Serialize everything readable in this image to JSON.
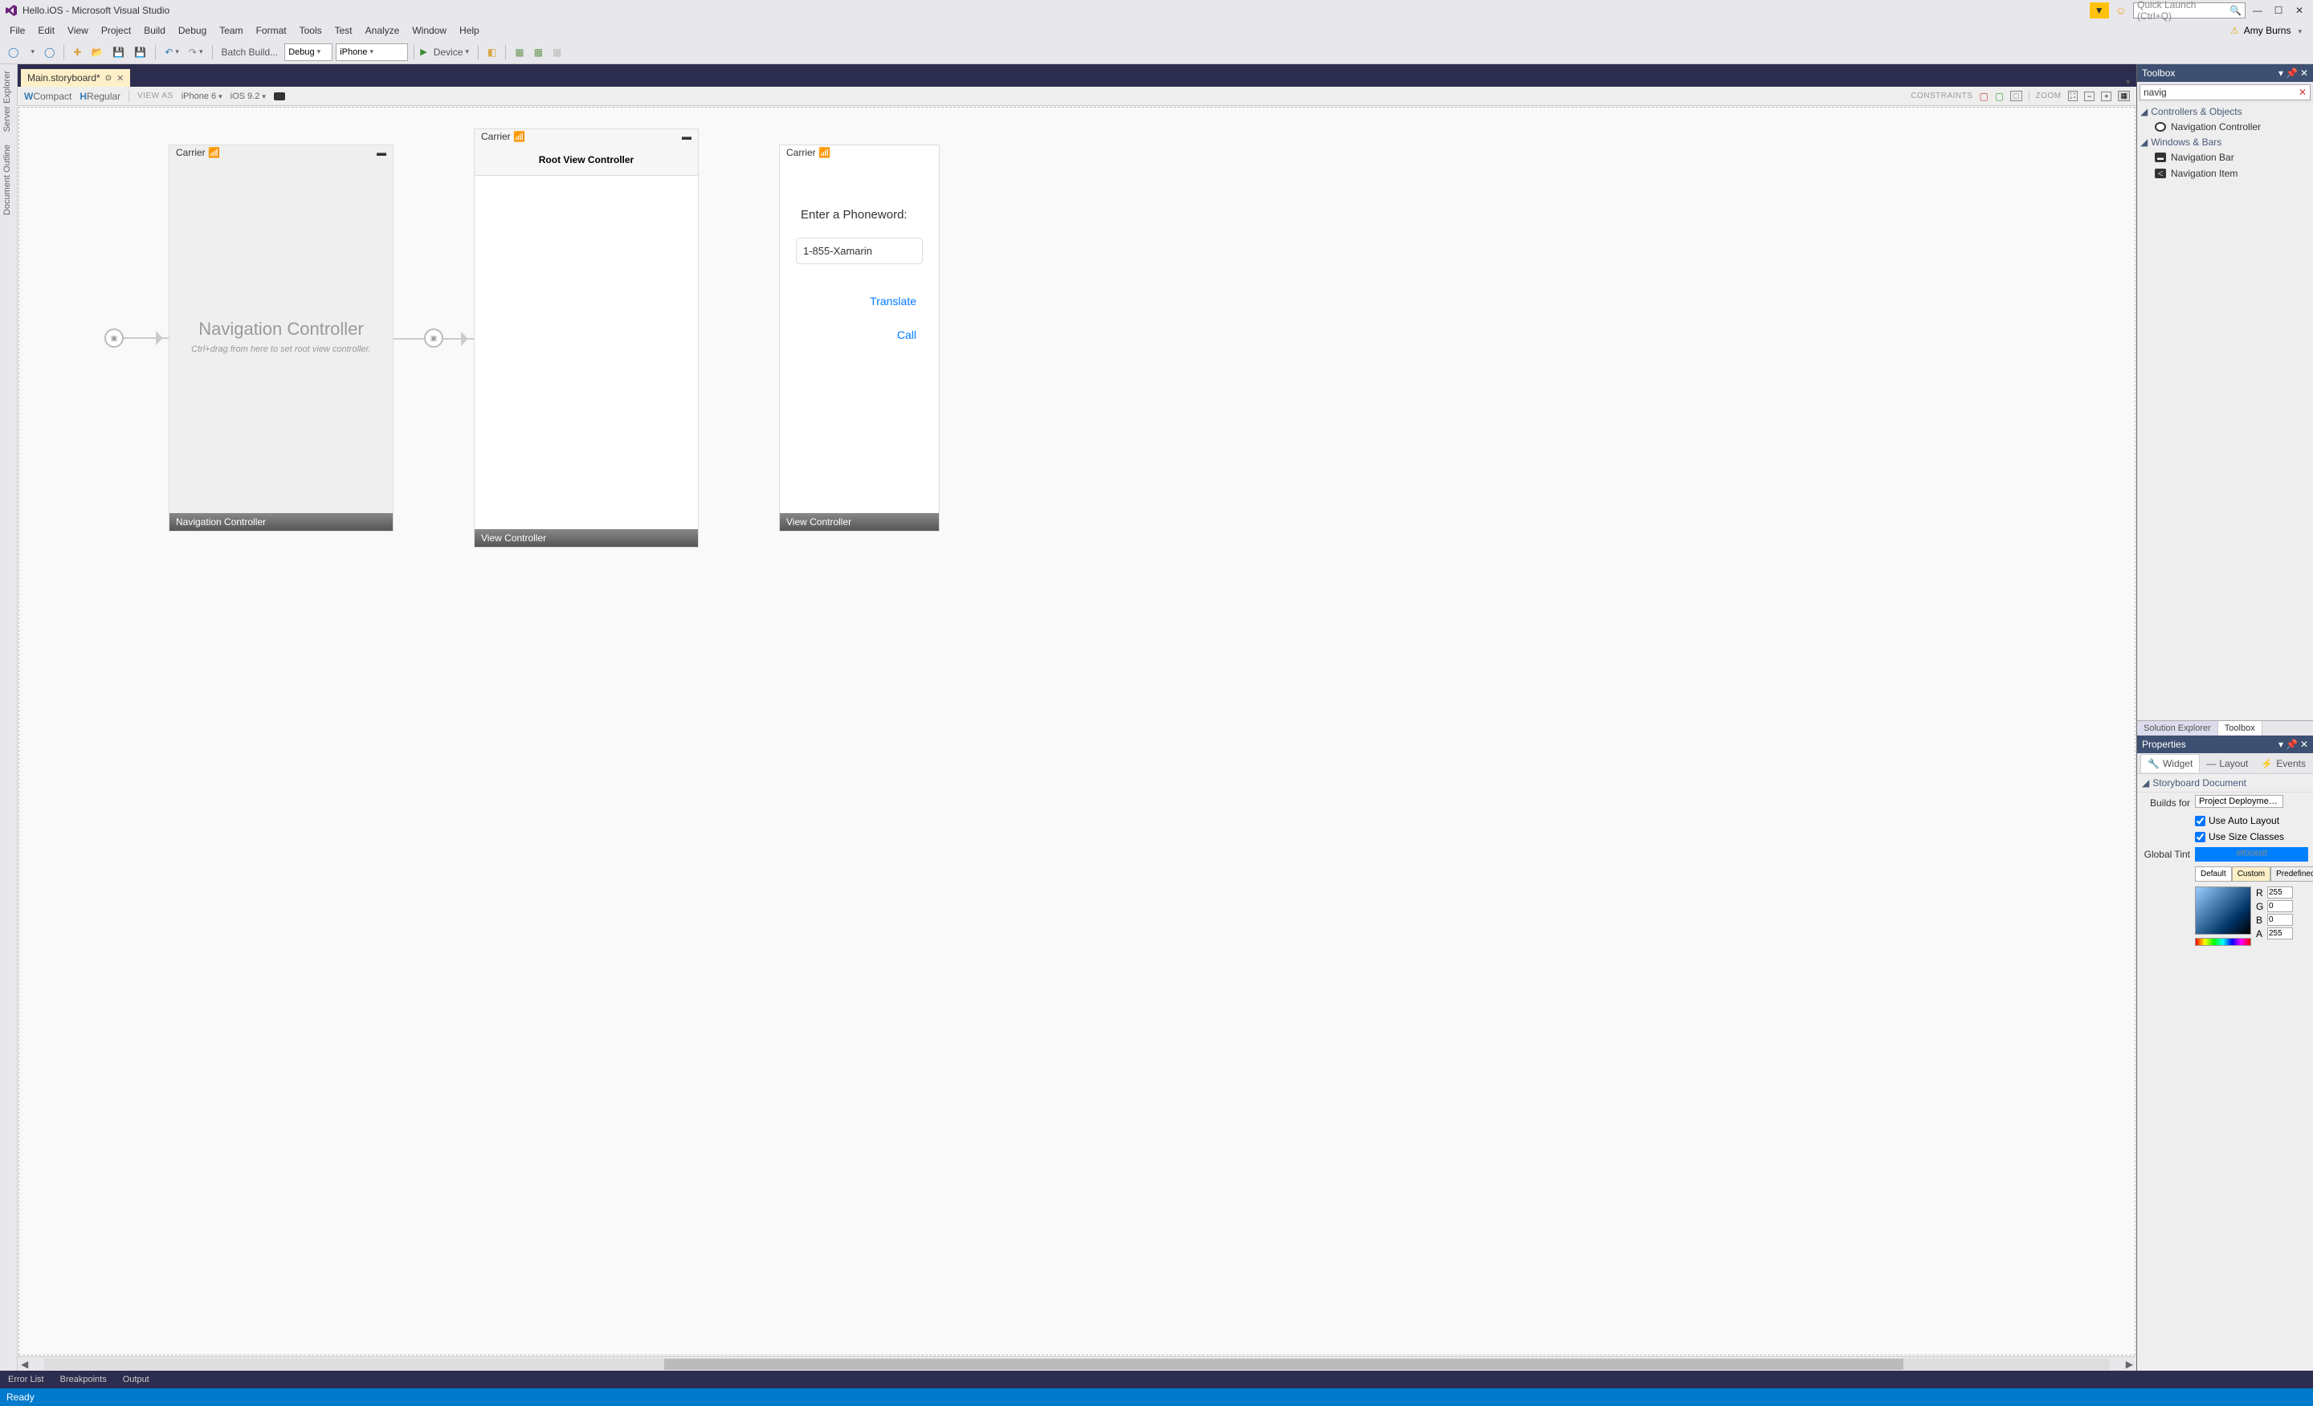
{
  "title": "Hello.iOS - Microsoft Visual Studio",
  "quick_launch_placeholder": "Quick Launch (Ctrl+Q)",
  "user_name": "Amy Burns",
  "menus": [
    "File",
    "Edit",
    "View",
    "Project",
    "Build",
    "Debug",
    "Team",
    "Format",
    "Tools",
    "Test",
    "Analyze",
    "Window",
    "Help"
  ],
  "toolbar": {
    "batch_build": "Batch Build...",
    "config": "Debug",
    "platform": "iPhone",
    "device": "Device"
  },
  "side_tabs": [
    "Server Explorer",
    "Document Outline"
  ],
  "doc_tab": "Main.storyboard*",
  "designer_bar": {
    "w_label": "W",
    "w_val": "Compact",
    "h_label": "H",
    "h_val": "Regular",
    "view_as": "VIEW AS",
    "device": "iPhone 6",
    "ios": "iOS 9.2",
    "constraints": "CONSTRAINTS",
    "zoom": "ZOOM"
  },
  "scene1": {
    "carrier": "Carrier",
    "title": "Navigation Controller",
    "sub": "Ctrl+drag from here to set root view controller.",
    "footer": "Navigation Controller"
  },
  "scene2": {
    "carrier": "Carrier",
    "header": "Root View Controller",
    "footer": "View Controller"
  },
  "scene3": {
    "carrier": "Carrier",
    "label": "Enter a Phoneword:",
    "input": "1-855-Xamarin",
    "btn1": "Translate",
    "btn2": "Call",
    "footer": "View Controller"
  },
  "toolbox": {
    "title": "Toolbox",
    "search": "navig",
    "group1": "Controllers & Objects",
    "item1": "Navigation Controller",
    "group2": "Windows & Bars",
    "item2": "Navigation Bar",
    "item3": "Navigation Item"
  },
  "bottom_right_tabs": {
    "t1": "Solution Explorer",
    "t2": "Toolbox"
  },
  "properties": {
    "title": "Properties",
    "tabs": {
      "widget": "Widget",
      "layout": "Layout",
      "events": "Events"
    },
    "section": "Storyboard Document",
    "builds_for": "Builds for",
    "builds_val": "Project Deployment Target",
    "auto_layout": "Use Auto Layout",
    "size_classes": "Use Size Classes",
    "global_tint": "Global Tint",
    "tint_val": "#ff0086ff",
    "btns": {
      "default": "Default",
      "custom": "Custom",
      "predef": "Predefined"
    },
    "r": "255",
    "g": "0",
    "b": "0",
    "a": "255"
  },
  "bottom_tabs": [
    "Error List",
    "Breakpoints",
    "Output"
  ],
  "status": "Ready"
}
